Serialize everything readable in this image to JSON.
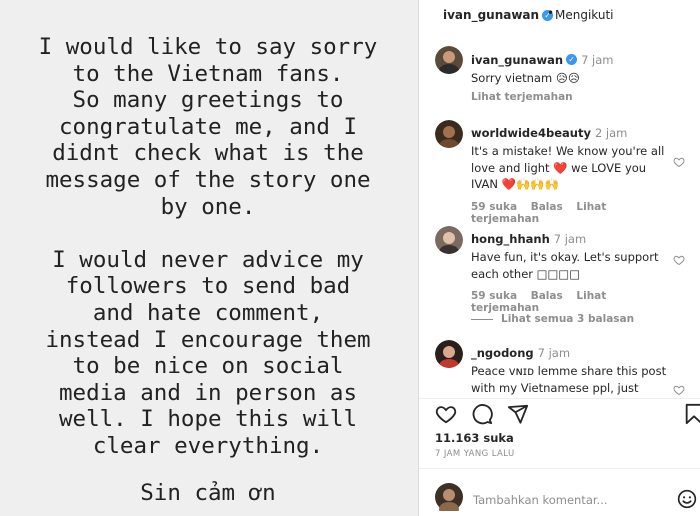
{
  "story": {
    "paragraph1": [
      "I would like to say sorry",
      "to the Vietnam fans.",
      "So many greetings to",
      "congratulate me, and I",
      "didnt check what is the",
      "message of the story one",
      "by one."
    ],
    "paragraph2": [
      "I would never advice my",
      "followers to send bad",
      "and hate comment,",
      "instead I encourage them",
      "to be nice on social",
      "media and in person as",
      "well. I hope this will",
      "clear everything."
    ],
    "signoff": "Sin cảm ơn"
  },
  "header": {
    "username": "ivan_gunawan",
    "dot": "•",
    "follow_status": "Mengikuti"
  },
  "caption": {
    "username": "ivan_gunawan",
    "time": "7 jam",
    "text": "Sorry vietnam 😥😥",
    "translate": "Lihat terjemahan"
  },
  "comments": [
    {
      "username": "worldwide4beauty",
      "time": "2 jam",
      "text": "It's a mistake! We know you're all love and light ❤️ we LOVE you IVAN ❤️🙌🙌🙌",
      "likes": "59 suka",
      "reply": "Balas",
      "translate": "Lihat terjemahan"
    },
    {
      "username": "hong_hhanh",
      "time": "7 jam",
      "text": "Have fun, it's okay. Let's support each other □□□□",
      "likes": "59 suka",
      "reply": "Balas",
      "translate": "Lihat terjemahan"
    },
    {
      "username": "_ngodong",
      "time": "7 jam",
      "text": "Peace ᴠɴɪᴅ lemme share this post with my Vietnamese ppl, just"
    }
  ],
  "view_replies": "Lihat semua 3 balasan",
  "likes_count": "11.163 suka",
  "time_ago": "7 JAM YANG LALU",
  "add_comment_placeholder": "Tambahkan komentar...",
  "colors": {
    "verified": "#3897f0",
    "story_bg": "#efefef",
    "heart_red": "#ed4956"
  },
  "icons": [
    "verified-badge-icon",
    "heart-icon",
    "comment-icon",
    "share-icon",
    "bookmark-icon",
    "emoji-icon"
  ]
}
